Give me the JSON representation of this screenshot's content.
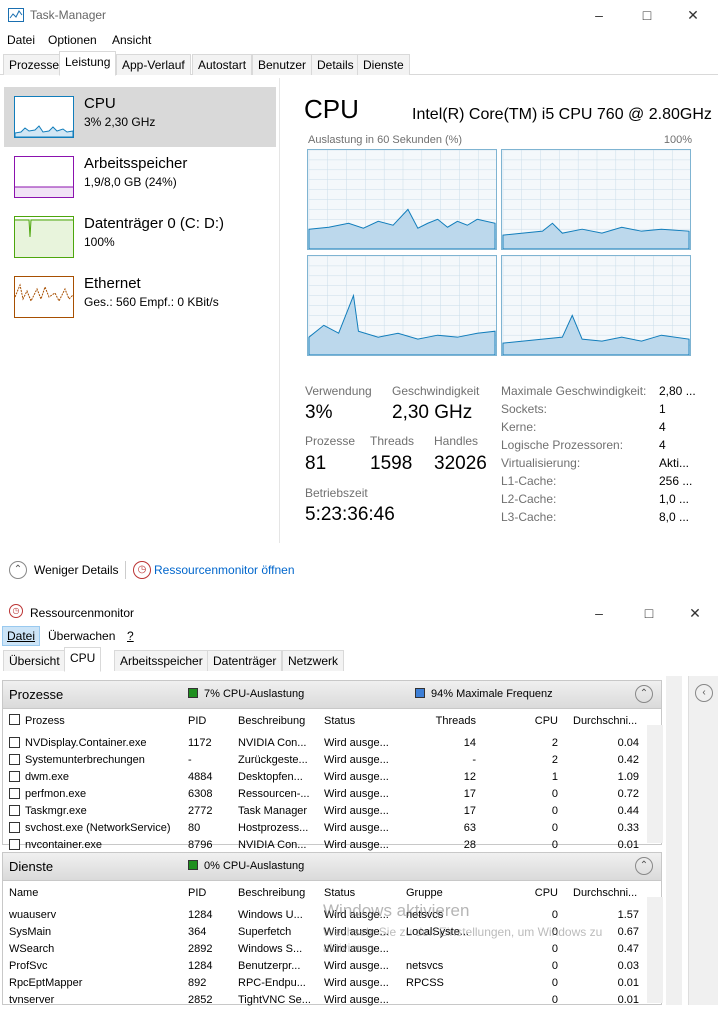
{
  "tm": {
    "title": "Task-Manager",
    "menu": [
      "Datei",
      "Optionen",
      "Ansicht"
    ],
    "tabs": [
      "Prozesse",
      "Leistung",
      "App-Verlauf",
      "Autostart",
      "Benutzer",
      "Details",
      "Dienste"
    ],
    "perf_items": [
      {
        "name": "CPU",
        "sub": "3% 2,30 GHz",
        "color": "#117dbb"
      },
      {
        "name": "Arbeitsspeicher",
        "sub": "1,9/8,0 GB (24%)",
        "color": "#8b12ae"
      },
      {
        "name": "Datenträger 0 (C: D:)",
        "sub": "100%",
        "color": "#4da60c"
      },
      {
        "name": "Ethernet",
        "sub": "Ges.: 560 Empf.: 0 KBit/s",
        "color": "#a74f01"
      }
    ],
    "cpu": {
      "title": "CPU",
      "model": "Intel(R) Core(TM) i5 CPU 760 @ 2.80GHz",
      "graph_label": "Auslastung in 60 Sekunden (%)",
      "graph_max": "100%",
      "stats": {
        "usage_label": "Verwendung",
        "usage": "3%",
        "speed_label": "Geschwindigkeit",
        "speed": "2,30 GHz",
        "proc_label": "Prozesse",
        "proc": "81",
        "threads_label": "Threads",
        "threads": "1598",
        "handles_label": "Handles",
        "handles": "32026",
        "uptime_label": "Betriebszeit",
        "uptime": "5:23:36:46"
      },
      "details": [
        {
          "k": "Maximale Geschwindigkeit:",
          "v": "2,80 ..."
        },
        {
          "k": "Sockets:",
          "v": "1"
        },
        {
          "k": "Kerne:",
          "v": "4"
        },
        {
          "k": "Logische Prozessoren:",
          "v": "4"
        },
        {
          "k": "Virtualisierung:",
          "v": "Akti..."
        },
        {
          "k": "L1-Cache:",
          "v": "256 ..."
        },
        {
          "k": "L2-Cache:",
          "v": "1,0 ..."
        },
        {
          "k": "L3-Cache:",
          "v": "8,0 ..."
        }
      ]
    },
    "footer": {
      "less": "Weniger Details",
      "resmon": "Ressourcenmonitor öffnen"
    }
  },
  "rm": {
    "title": "Ressourcenmonitor",
    "menu": [
      "Datei",
      "Überwachen",
      "?"
    ],
    "tabs": [
      "Übersicht",
      "CPU",
      "Arbeitsspeicher",
      "Datenträger",
      "Netzwerk"
    ],
    "proc": {
      "title": "Prozesse",
      "ind1": "7% CPU-Auslastung",
      "ind2": "94% Maximale Frequenz",
      "cols": [
        "Prozess",
        "PID",
        "Beschreibung",
        "Status",
        "Threads",
        "CPU",
        "Durchschni..."
      ],
      "rows": [
        [
          "NVDisplay.Container.exe",
          "1172",
          "NVIDIA Con...",
          "Wird ausge...",
          "14",
          "2",
          "0.04"
        ],
        [
          "Systemunterbrechungen",
          "-",
          "Zurückgeste...",
          "Wird ausge...",
          "-",
          "2",
          "0.42"
        ],
        [
          "dwm.exe",
          "4884",
          "Desktopfen...",
          "Wird ausge...",
          "12",
          "1",
          "1.09"
        ],
        [
          "perfmon.exe",
          "6308",
          "Ressourcen-...",
          "Wird ausge...",
          "17",
          "0",
          "0.72"
        ],
        [
          "Taskmgr.exe",
          "2772",
          "Task Manager",
          "Wird ausge...",
          "17",
          "0",
          "0.44"
        ],
        [
          "svchost.exe (NetworkService)",
          "80",
          "Hostprozess...",
          "Wird ausge...",
          "63",
          "0",
          "0.33"
        ],
        [
          "nvcontainer.exe",
          "8796",
          "NVIDIA Con...",
          "Wird ausge...",
          "28",
          "0",
          "0.01"
        ]
      ]
    },
    "svc": {
      "title": "Dienste",
      "ind1": "0% CPU-Auslastung",
      "cols": [
        "Name",
        "PID",
        "Beschreibung",
        "Status",
        "Gruppe",
        "CPU",
        "Durchschni..."
      ],
      "rows": [
        [
          "wuauserv",
          "1284",
          "Windows U...",
          "Wird ausge...",
          "netsvcs",
          "0",
          "1.57"
        ],
        [
          "SysMain",
          "364",
          "Superfetch",
          "Wird ausge...",
          "LocalSyste...",
          "0",
          "0.67"
        ],
        [
          "WSearch",
          "2892",
          "Windows S...",
          "Wird ausge...",
          "",
          "0",
          "0.47"
        ],
        [
          "ProfSvc",
          "1284",
          "Benutzerpr...",
          "Wird ausge...",
          "netsvcs",
          "0",
          "0.03"
        ],
        [
          "RpcEptMapper",
          "892",
          "RPC-Endpu...",
          "Wird ausge...",
          "RPCSS",
          "0",
          "0.01"
        ],
        [
          "tvnserver",
          "2852",
          "TightVNC Se...",
          "Wird ausge...",
          "",
          "0",
          "0.01"
        ]
      ]
    },
    "watermark": {
      "line1": "Windows aktivieren",
      "line2": "Wechseln Sie zu den Einstellungen, um Windows zu",
      "line3": "aktivieren."
    }
  }
}
